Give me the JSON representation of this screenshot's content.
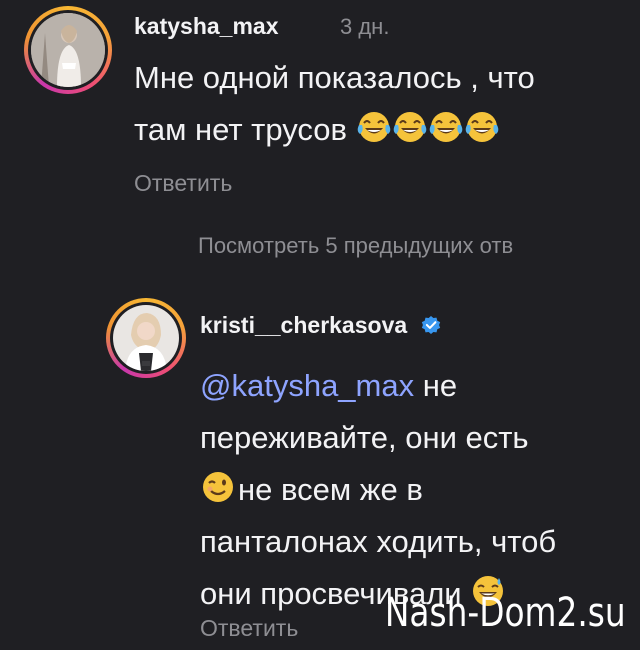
{
  "comments": [
    {
      "username": "katysha_max",
      "time": "3 дн.",
      "lines": [
        "Мне одной показалось , что",
        "там нет трусов"
      ],
      "emojis": [
        "face-with-tears-of-joy-icon",
        "face-with-tears-of-joy-icon",
        "face-with-tears-of-joy-icon",
        "face-with-tears-of-joy-icon"
      ],
      "reply_label": "Ответить"
    },
    {
      "username": "kristi__cherkasova",
      "verified": true,
      "mention": "@katysha_max",
      "line1_rest": " не",
      "line2": "переживайте, они есть",
      "line3": "не всем же в",
      "line4": "панталонах ходить, чтоб",
      "line5": "они просвечивали",
      "reply_label": "Ответить"
    }
  ],
  "view_replies": "Посмотреть 5 предыдущих отв",
  "watermark": "Nash-Dom2.su",
  "colors": {
    "background": "#1f1f23",
    "text": "#f3f3f5",
    "muted": "#8e8e93",
    "mention": "#8ea4ff",
    "verified": "#3897f0"
  }
}
